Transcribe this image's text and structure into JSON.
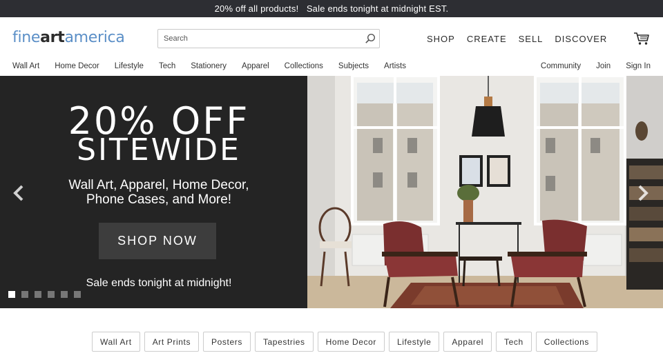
{
  "promo": {
    "text": "20% off all products!   Sale ends tonight at midnight EST."
  },
  "header": {
    "logo": {
      "part1": "fine",
      "part2": "art",
      "part3": "america"
    },
    "search": {
      "placeholder": "Search",
      "value": ""
    },
    "nav": [
      "SHOP",
      "CREATE",
      "SELL",
      "DISCOVER"
    ],
    "cart_icon": "shopping-cart-icon",
    "search_icon": "magnifier-icon"
  },
  "subnav": {
    "left": [
      "Wall Art",
      "Home Decor",
      "Lifestyle",
      "Tech",
      "Stationery",
      "Apparel",
      "Collections",
      "Subjects",
      "Artists"
    ],
    "right": [
      "Community",
      "Join",
      "Sign In"
    ]
  },
  "hero": {
    "title_line1": "20% OFF",
    "title_line2": "SITEWIDE",
    "subtitle_line1": "Wall Art, Apparel, Home Decor,",
    "subtitle_line2": "Phone Cases, and More!",
    "cta": "SHOP NOW",
    "note": "Sale ends tonight at midnight!",
    "slide_count": 6,
    "active_slide": 0
  },
  "chips": [
    "Wall Art",
    "Art Prints",
    "Posters",
    "Tapestries",
    "Home Decor",
    "Lifestyle",
    "Apparel",
    "Tech",
    "Collections"
  ],
  "colors": {
    "promo_bg": "#2d2e33",
    "logo_blue": "#5b8fc7",
    "hero_dark": "#242424",
    "button_bg": "#3d3d3d"
  }
}
